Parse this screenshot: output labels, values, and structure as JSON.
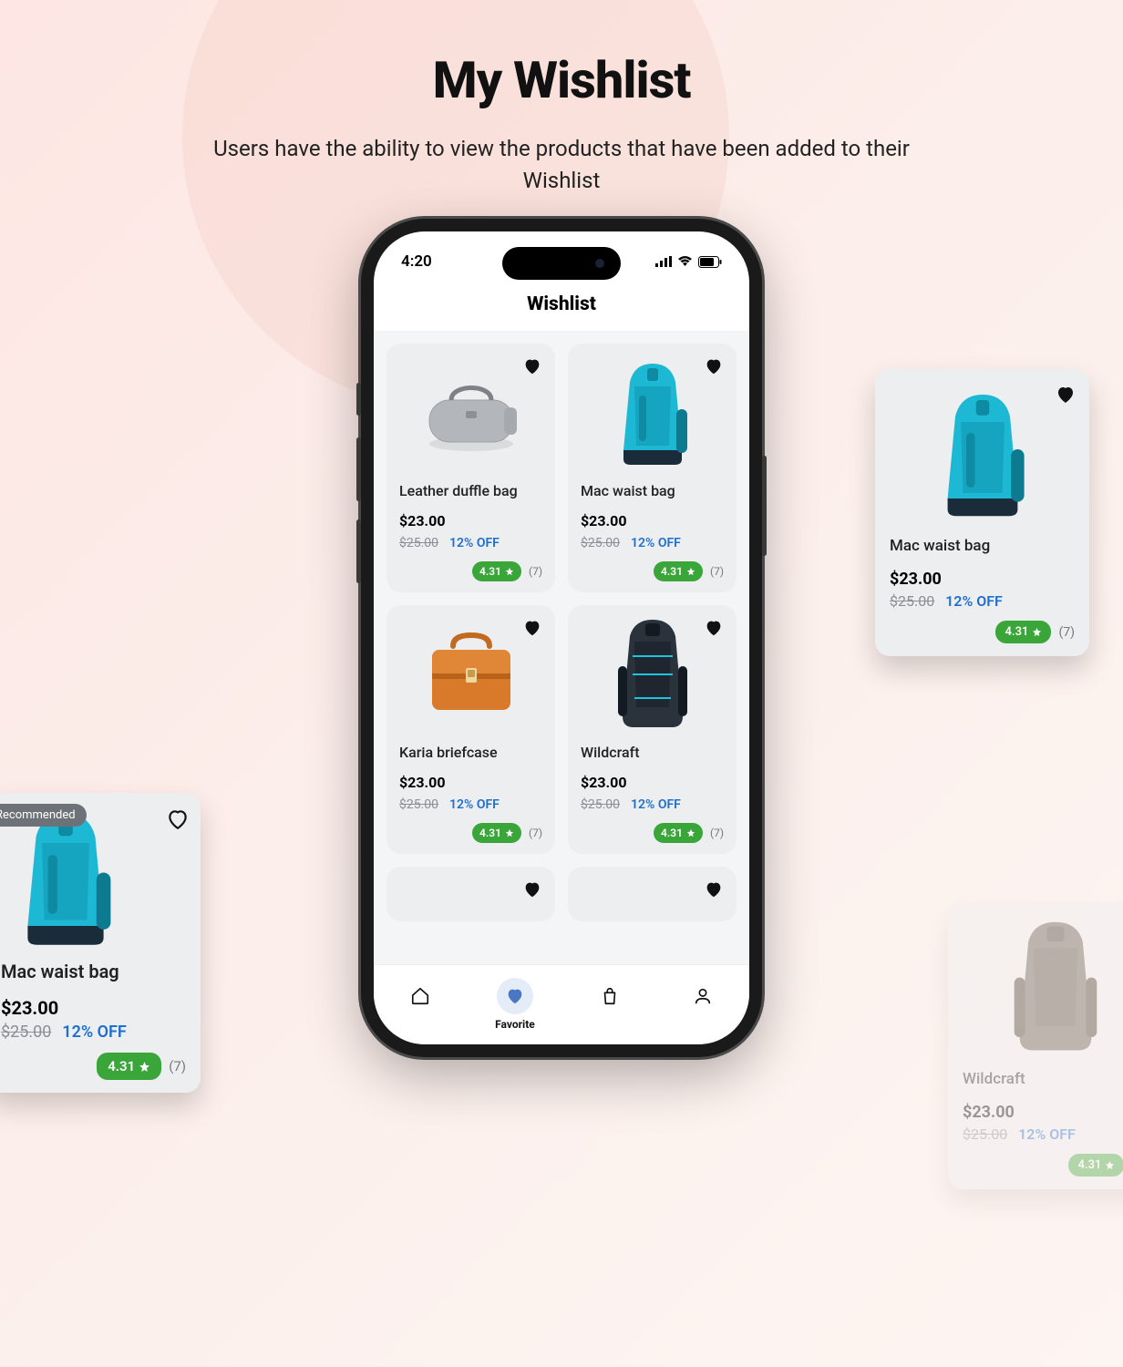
{
  "hero": {
    "title": "My Wishlist",
    "subtitle": "Users have the ability to view the products that have been added to their Wishlist"
  },
  "status": {
    "time": "4:20"
  },
  "appHeader": {
    "title": "Wishlist"
  },
  "nav": {
    "favoriteLabel": "Favorite"
  },
  "products": {
    "leatherDuffle": {
      "name": "Leather duffle bag",
      "price": "$23.00",
      "old": "$25.00",
      "discount": "12% OFF",
      "rating": "4.31",
      "reviews": "(7)"
    },
    "macWaist": {
      "name": "Mac waist bag",
      "price": "$23.00",
      "old": "$25.00",
      "discount": "12% OFF",
      "rating": "4.31",
      "reviews": "(7)"
    },
    "karia": {
      "name": "Karia briefcase",
      "price": "$23.00",
      "old": "$25.00",
      "discount": "12% OFF",
      "rating": "4.31",
      "reviews": "(7)"
    },
    "wildcraft": {
      "name": "Wildcraft",
      "price": "$23.00",
      "old": "$25.00",
      "discount": "12% OFF",
      "rating": "4.31",
      "reviews": "(7)"
    }
  },
  "badge": {
    "recommended": "Recommended"
  }
}
